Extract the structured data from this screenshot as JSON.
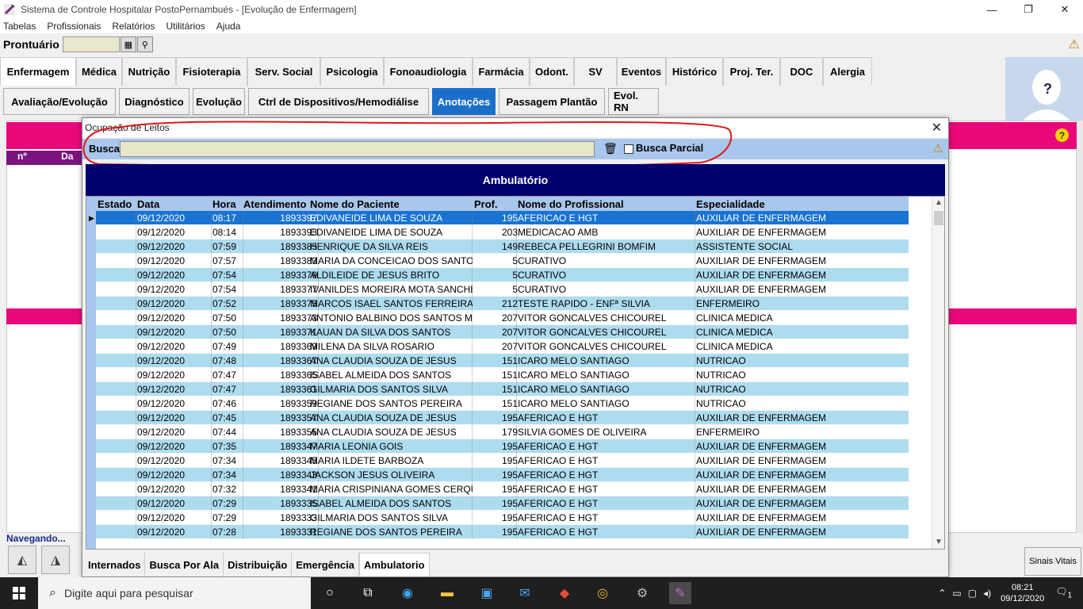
{
  "window": {
    "title": "Sistema de Controle Hospitalar PostoPernambués - [Evolução de Enfermagem]",
    "minimize": "—",
    "restore": "❐",
    "close": "✕"
  },
  "menu": [
    "Tabelas",
    "Profissionais",
    "Relatórios",
    "Utilitários",
    "Ajuda"
  ],
  "prontuario": {
    "label": "Prontuário",
    "value": ""
  },
  "specialty_tabs": [
    "Enfermagem",
    "Médica",
    "Nutrição",
    "Fisioterapia",
    "Serv. Social",
    "Psicologia",
    "Fonoaudiologia",
    "Farmácia",
    "Odont.",
    "SV",
    "Eventos",
    "Histórico",
    "Proj. Ter.",
    "DOC",
    "Alergia"
  ],
  "sub_tabs": [
    "Avaliação/Evolução",
    "Diagnóstico",
    "Evolução",
    "Ctrl de Dispositivos/Hemodiálise",
    "Anotações",
    "Passagem Plantão",
    "Evol. RN"
  ],
  "background": {
    "col_no": "nº",
    "col_d": "Da",
    "help": "?"
  },
  "dialog": {
    "title": "Ocupação de Leitos",
    "close": "✕",
    "search_label": "Busca",
    "search_value": "",
    "partial_label": "Busca Parcial",
    "section": "Ambulatório"
  },
  "columns": [
    "Estado",
    "Data",
    "Hora",
    "Atendimento",
    "Nome do Paciente",
    "Prof.",
    "Nome do Profissional",
    "Especialidade"
  ],
  "rows": [
    [
      "",
      "09/12/2020",
      "08:17",
      "1893397",
      "EDIVANEIDE LIMA DE SOUZA",
      "195",
      "AFERICAO E HGT",
      "AUXILIAR DE ENFERMAGEM"
    ],
    [
      "",
      "09/12/2020",
      "08:14",
      "1893393",
      "EDIVANEIDE LIMA DE SOUZA",
      "203",
      "MEDICACAO AMB",
      "AUXILIAR DE ENFERMAGEM"
    ],
    [
      "",
      "09/12/2020",
      "07:59",
      "1893385",
      "HENRIQUE DA SILVA REIS",
      "149",
      "REBECA PELLEGRINI BOMFIM",
      "ASSISTENTE SOCIAL"
    ],
    [
      "",
      "09/12/2020",
      "07:57",
      "1893383",
      "MARIA DA CONCEICAO DOS SANTOS",
      "5",
      "CURATIVO",
      "AUXILIAR DE ENFERMAGEM"
    ],
    [
      "",
      "09/12/2020",
      "07:54",
      "1893379",
      "ALDILEIDE DE JESUS BRITO",
      "5",
      "CURATIVO",
      "AUXILIAR DE ENFERMAGEM"
    ],
    [
      "",
      "09/12/2020",
      "07:54",
      "1893377",
      "IVANILDES MOREIRA MOTA SANCHES",
      "5",
      "CURATIVO",
      "AUXILIAR DE ENFERMAGEM"
    ],
    [
      "",
      "09/12/2020",
      "07:52",
      "1893375",
      "MARCOS ISAEL SANTOS FERREIRA",
      "212",
      "TESTE RAPIDO - ENFª SILVIA",
      "ENFERMEIRO"
    ],
    [
      "",
      "09/12/2020",
      "07:50",
      "1893373",
      "ANTONIO BALBINO DOS SANTOS MA",
      "207",
      "VITOR GONCALVES CHICOUREL",
      "CLINICA MEDICA"
    ],
    [
      "",
      "09/12/2020",
      "07:50",
      "1893371",
      "KAUAN DA SILVA DOS SANTOS",
      "207",
      "VITOR GONCALVES CHICOUREL",
      "CLINICA MEDICA"
    ],
    [
      "",
      "09/12/2020",
      "07:49",
      "1893369",
      "MILENA DA SILVA ROSARIO",
      "207",
      "VITOR GONCALVES CHICOUREL",
      "CLINICA MEDICA"
    ],
    [
      "",
      "09/12/2020",
      "07:48",
      "1893367",
      "ANA CLAUDIA SOUZA DE JESUS",
      "151",
      "ICARO MELO SANTIAGO",
      "NUTRICAO"
    ],
    [
      "",
      "09/12/2020",
      "07:47",
      "1893365",
      "ISABEL ALMEIDA DOS SANTOS",
      "151",
      "ICARO MELO SANTIAGO",
      "NUTRICAO"
    ],
    [
      "",
      "09/12/2020",
      "07:47",
      "1893361",
      "GILMARIA DOS SANTOS SILVA",
      "151",
      "ICARO MELO SANTIAGO",
      "NUTRICAO"
    ],
    [
      "",
      "09/12/2020",
      "07:46",
      "1893359",
      "REGIANE DOS SANTOS PEREIRA",
      "151",
      "ICARO MELO SANTIAGO",
      "NUTRICAO"
    ],
    [
      "",
      "09/12/2020",
      "07:45",
      "1893357",
      "ANA CLAUDIA SOUZA DE JESUS",
      "195",
      "AFERICAO E HGT",
      "AUXILIAR DE ENFERMAGEM"
    ],
    [
      "",
      "09/12/2020",
      "07:44",
      "1893355",
      "ANA CLAUDIA SOUZA DE JESUS",
      "179",
      "SILVIA GOMES DE OLIVEIRA",
      "ENFERMEIRO"
    ],
    [
      "",
      "09/12/2020",
      "07:35",
      "1893347",
      "MARIA LEONIA GOIS",
      "195",
      "AFERICAO E HGT",
      "AUXILIAR DE ENFERMAGEM"
    ],
    [
      "",
      "09/12/2020",
      "07:34",
      "1893345",
      "MARIA ILDETE BARBOZA",
      "195",
      "AFERICAO E HGT",
      "AUXILIAR DE ENFERMAGEM"
    ],
    [
      "",
      "09/12/2020",
      "07:34",
      "1893343",
      "JACKSON JESUS OLIVEIRA",
      "195",
      "AFERICAO E HGT",
      "AUXILIAR DE ENFERMAGEM"
    ],
    [
      "",
      "09/12/2020",
      "07:32",
      "1893341",
      "MARIA CRISPINIANA GOMES CERQU",
      "195",
      "AFERICAO E HGT",
      "AUXILIAR DE ENFERMAGEM"
    ],
    [
      "",
      "09/12/2020",
      "07:29",
      "1893335",
      "ISABEL ALMEIDA DOS SANTOS",
      "195",
      "AFERICAO E HGT",
      "AUXILIAR DE ENFERMAGEM"
    ],
    [
      "",
      "09/12/2020",
      "07:29",
      "1893333",
      "GILMARIA DOS SANTOS SILVA",
      "195",
      "AFERICAO E HGT",
      "AUXILIAR DE ENFERMAGEM"
    ],
    [
      "",
      "09/12/2020",
      "07:28",
      "1893331",
      "REGIANE DOS SANTOS PEREIRA",
      "195",
      "AFERICAO E HGT",
      "AUXILIAR DE ENFERMAGEM"
    ]
  ],
  "bottom_tabs": [
    "Internados",
    "Busca Por Ala",
    "Distribuição",
    "Emergência",
    "Ambulatorio"
  ],
  "nav_label": "Navegando...",
  "sinais_vitais": "Sinais Vitais",
  "taskbar": {
    "search_placeholder": "Digite aqui para pesquisar",
    "time": "08:21",
    "date": "09/12/2020",
    "notifications": "1"
  },
  "colors": {
    "selected_row": "#1a73d1",
    "row_alt": "#aedcef",
    "header": "#00006e",
    "pink_bar": "#e8087a",
    "active_subtab": "#1c6fc9"
  }
}
